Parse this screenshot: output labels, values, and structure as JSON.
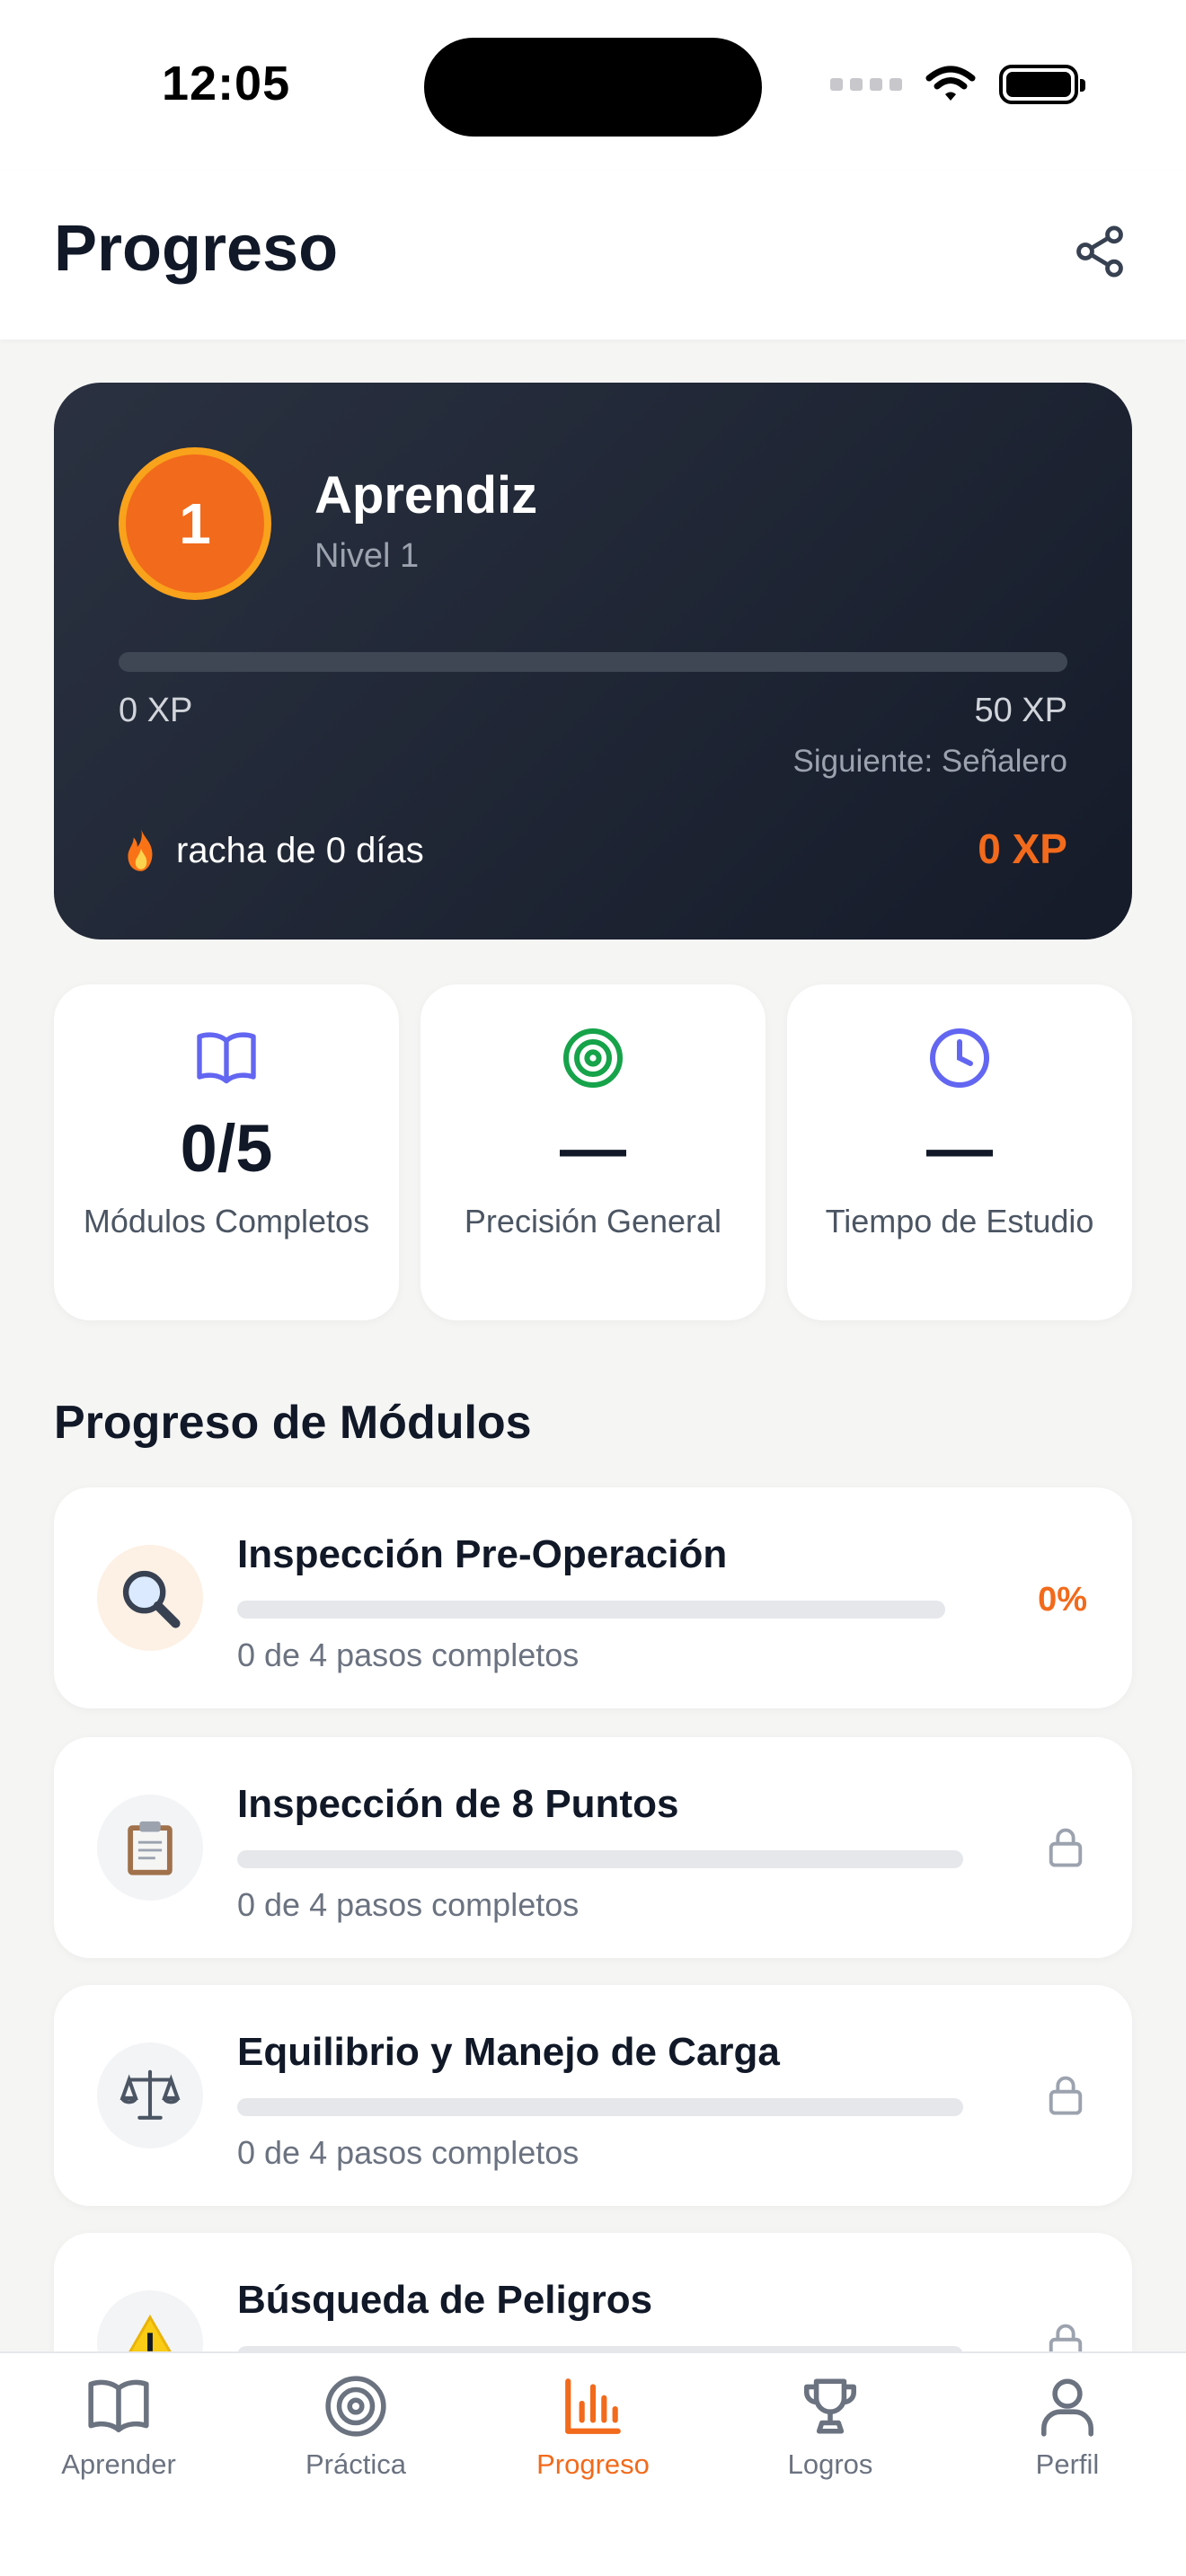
{
  "status_bar": {
    "time": "12:05"
  },
  "header": {
    "title": "Progreso",
    "share_icon": "share-icon"
  },
  "level_card": {
    "level_number": "1",
    "level_name": "Aprendiz",
    "level_subtitle": "Nivel 1",
    "xp_min_label": "0 XP",
    "xp_max_label": "50 XP",
    "xp_progress_fraction": 0,
    "next_level_label": "Siguiente: Señalero",
    "streak_label": "racha de 0 días",
    "streak_icon": "fire-icon",
    "xp_total": "0 XP",
    "accent_color": "#f26a1b"
  },
  "stats": [
    {
      "icon": "book-icon",
      "value": "0/5",
      "label": "Módulos Completos"
    },
    {
      "icon": "target-icon",
      "value": "—",
      "label": "Precisión General"
    },
    {
      "icon": "clock-icon",
      "value": "—",
      "label": "Tiempo de Estudio"
    }
  ],
  "modules_section": {
    "title": "Progreso de Módulos",
    "modules": [
      {
        "icon": "magnifier-icon",
        "title": "Inspección Pre-Operación",
        "subtitle": "0 de 4 pasos completos",
        "percent": "0%",
        "progress_fraction": 0,
        "locked": false
      },
      {
        "icon": "clipboard-icon",
        "title": "Inspección de 8 Puntos",
        "subtitle": "0 de 4 pasos completos",
        "progress_fraction": 0,
        "locked": true
      },
      {
        "icon": "scales-icon",
        "title": "Equilibrio y Manejo de Carga",
        "subtitle": "0 de 4 pasos completos",
        "progress_fraction": 0,
        "locked": true
      },
      {
        "icon": "warning-icon",
        "title": "Búsqueda de Peligros",
        "progress_fraction": 0,
        "locked": true
      }
    ]
  },
  "bottom_nav": {
    "items": [
      {
        "label": "Aprender",
        "icon": "book-icon"
      },
      {
        "label": "Práctica",
        "icon": "target-icon"
      },
      {
        "label": "Progreso",
        "icon": "bar-chart-icon",
        "active": true
      },
      {
        "label": "Logros",
        "icon": "trophy-icon"
      },
      {
        "label": "Perfil",
        "icon": "user-icon"
      }
    ]
  }
}
